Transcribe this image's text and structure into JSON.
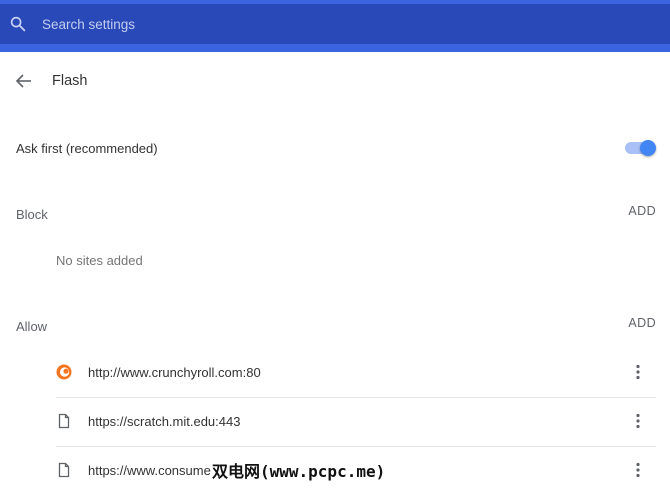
{
  "search": {
    "placeholder": "Search settings"
  },
  "page": {
    "title": "Flash"
  },
  "ask_first": {
    "label": "Ask first (recommended)",
    "enabled": true
  },
  "block": {
    "label": "Block",
    "add_label": "ADD",
    "empty_text": "No sites added"
  },
  "allow": {
    "label": "Allow",
    "add_label": "ADD",
    "sites": [
      {
        "url": "http://www.crunchyroll.com:80",
        "icon": "crunchyroll-icon"
      },
      {
        "url": "https://scratch.mit.edu:443",
        "icon": "page-icon"
      },
      {
        "url": "https://www.consume",
        "icon": "page-icon"
      }
    ]
  },
  "watermark": {
    "text": "双电网(www.pcpc.me)"
  },
  "colors": {
    "toolbar": "#2a49b8",
    "toolbar_band": "#3b64e0",
    "toggle_on": "#4285f4",
    "toggle_track": "#a9c1f7",
    "crunchyroll": "#f47521"
  }
}
